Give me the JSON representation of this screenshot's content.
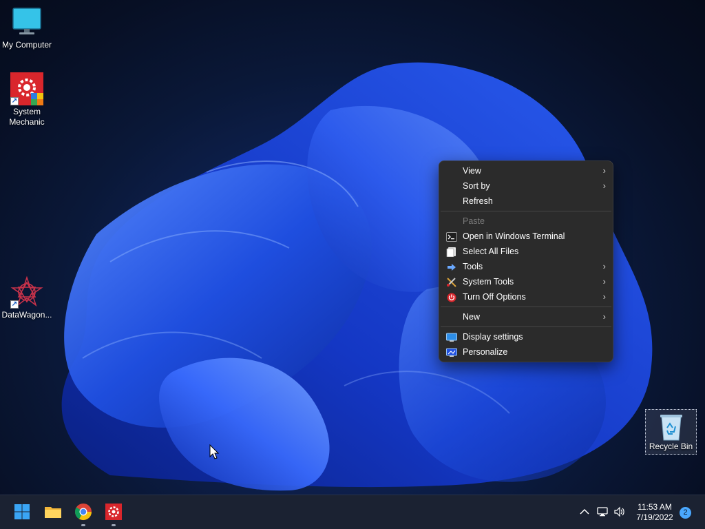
{
  "desktop": {
    "icons": [
      {
        "label": "My Computer"
      },
      {
        "label": "System Mechanic"
      },
      {
        "label": "DataWagon..."
      }
    ],
    "recycle_bin": {
      "label": "Recycle Bin"
    }
  },
  "context_menu": {
    "items": [
      {
        "label": "View",
        "submenu": true,
        "icon": "none"
      },
      {
        "label": "Sort by",
        "submenu": true,
        "icon": "none"
      },
      {
        "label": "Refresh",
        "submenu": false,
        "icon": "none"
      },
      {
        "label": "Paste",
        "submenu": false,
        "icon": "none",
        "disabled": true
      },
      {
        "label": "Open in Windows Terminal",
        "submenu": false,
        "icon": "terminal-icon"
      },
      {
        "label": "Select All Files",
        "submenu": false,
        "icon": "select-files-icon"
      },
      {
        "label": "Tools",
        "submenu": true,
        "icon": "arrow-right-icon"
      },
      {
        "label": "System Tools",
        "submenu": true,
        "icon": "tools-icon"
      },
      {
        "label": "Turn Off Options",
        "submenu": true,
        "icon": "power-icon"
      },
      {
        "label": "New",
        "submenu": true,
        "icon": "none"
      },
      {
        "label": "Display settings",
        "submenu": false,
        "icon": "display-icon"
      },
      {
        "label": "Personalize",
        "submenu": false,
        "icon": "personalize-icon"
      }
    ]
  },
  "taskbar": {
    "apps": [
      "start-icon",
      "file-explorer-icon",
      "chrome-icon",
      "system-mechanic-icon"
    ],
    "time": "11:53 AM",
    "date": "7/19/2022",
    "notification_count": "2"
  },
  "colors": {
    "accent": "#1f6fff",
    "menu_bg": "#2b2b2b",
    "taskbar_bg": "#1b2232"
  }
}
